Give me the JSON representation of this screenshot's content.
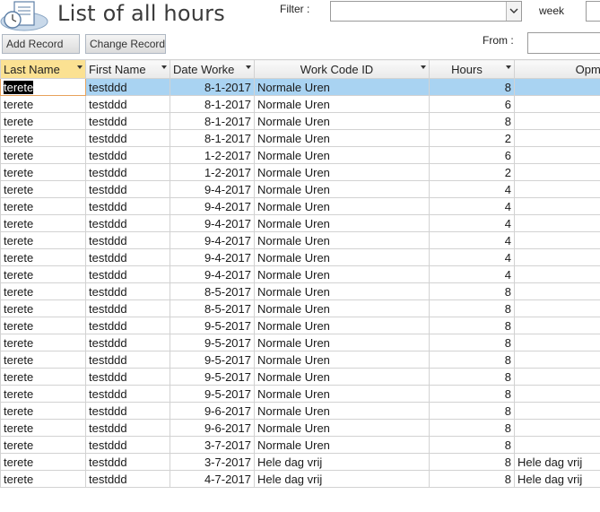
{
  "header": {
    "title": "List of all hours",
    "filter_label": "Filter :",
    "filter_value": "",
    "week_label": "week",
    "week_value": "",
    "from_label": "From :",
    "from_value": ""
  },
  "toolbar": {
    "add_label": "Add Record",
    "change_label": "Change Record"
  },
  "columns": [
    "Last Name",
    "First Name",
    "Date Worke",
    "Work Code ID",
    "Hours",
    "Opmer"
  ],
  "rows": [
    [
      "terete",
      "testddd",
      "8-1-2017",
      "Normale Uren",
      "8",
      ""
    ],
    [
      "terete",
      "testddd",
      "8-1-2017",
      "Normale Uren",
      "6",
      ""
    ],
    [
      "terete",
      "testddd",
      "8-1-2017",
      "Normale Uren",
      "8",
      ""
    ],
    [
      "terete",
      "testddd",
      "8-1-2017",
      "Normale Uren",
      "2",
      ""
    ],
    [
      "terete",
      "testddd",
      "1-2-2017",
      "Normale Uren",
      "6",
      ""
    ],
    [
      "terete",
      "testddd",
      "1-2-2017",
      "Normale Uren",
      "2",
      ""
    ],
    [
      "terete",
      "testddd",
      "9-4-2017",
      "Normale Uren",
      "4",
      ""
    ],
    [
      "terete",
      "testddd",
      "9-4-2017",
      "Normale Uren",
      "4",
      ""
    ],
    [
      "terete",
      "testddd",
      "9-4-2017",
      "Normale Uren",
      "4",
      ""
    ],
    [
      "terete",
      "testddd",
      "9-4-2017",
      "Normale Uren",
      "4",
      ""
    ],
    [
      "terete",
      "testddd",
      "9-4-2017",
      "Normale Uren",
      "4",
      ""
    ],
    [
      "terete",
      "testddd",
      "9-4-2017",
      "Normale Uren",
      "4",
      ""
    ],
    [
      "terete",
      "testddd",
      "8-5-2017",
      "Normale Uren",
      "8",
      ""
    ],
    [
      "terete",
      "testddd",
      "8-5-2017",
      "Normale Uren",
      "8",
      ""
    ],
    [
      "terete",
      "testddd",
      "9-5-2017",
      "Normale Uren",
      "8",
      ""
    ],
    [
      "terete",
      "testddd",
      "9-5-2017",
      "Normale Uren",
      "8",
      ""
    ],
    [
      "terete",
      "testddd",
      "9-5-2017",
      "Normale Uren",
      "8",
      ""
    ],
    [
      "terete",
      "testddd",
      "9-5-2017",
      "Normale Uren",
      "8",
      ""
    ],
    [
      "terete",
      "testddd",
      "9-5-2017",
      "Normale Uren",
      "8",
      ""
    ],
    [
      "terete",
      "testddd",
      "9-6-2017",
      "Normale Uren",
      "8",
      ""
    ],
    [
      "terete",
      "testddd",
      "9-6-2017",
      "Normale Uren",
      "8",
      ""
    ],
    [
      "terete",
      "testddd",
      "3-7-2017",
      "Normale Uren",
      "8",
      ""
    ],
    [
      "terete",
      "testddd",
      "3-7-2017",
      "Hele dag vrij",
      "8",
      "Hele dag vrij"
    ],
    [
      "terete",
      "testddd",
      "4-7-2017",
      "Hele dag vrij",
      "8",
      "Hele dag vrij"
    ]
  ],
  "selected_row": 0,
  "colors": {
    "selected_row": "#a9d3f2",
    "active_header": "#fbe192"
  }
}
